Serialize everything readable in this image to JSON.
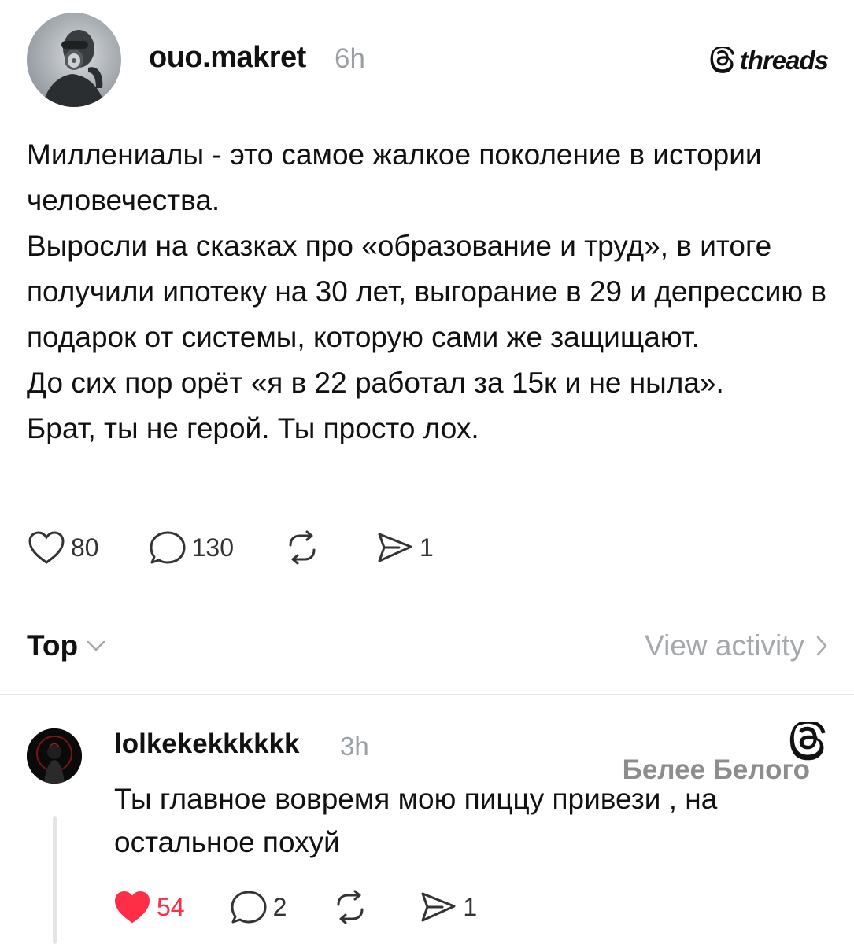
{
  "post": {
    "username": "ouo.makret",
    "time": "6h",
    "brand": "threads",
    "paragraphs": [
      "Миллениалы - это самое жалкое поколение в истории человечества.",
      "Выросли на сказках про «образование и труд», в итоге получили ипотеку на 30 лет, выгорание в 29 и депрессию в подарок от системы, которую сами же защищают.",
      "До сих пор орёт «я в 22 работал за 15к и не ныла».",
      "Брат, ты не герой. Ты просто лох."
    ],
    "actions": {
      "likes": "80",
      "comments": "130",
      "reposts": "",
      "shares": "1"
    }
  },
  "sort": {
    "label": "Top",
    "view_activity": "View activity"
  },
  "reply": {
    "username": "lolkekekkkkkk",
    "time": "3h",
    "text": "Ты главное вовремя мою пиццу привези , на остальное похуй",
    "actions": {
      "likes": "54",
      "comments": "2",
      "reposts": "",
      "shares": "1"
    }
  },
  "watermark": {
    "text": "Белее Белого"
  },
  "colors": {
    "like_red": "#ff2d45",
    "muted": "#9aa0a6",
    "text": "#111111"
  },
  "icons": {
    "like": "heart-icon",
    "comment": "comment-icon",
    "repost": "repost-icon",
    "share": "share-icon",
    "brand": "threads-logo-icon"
  }
}
